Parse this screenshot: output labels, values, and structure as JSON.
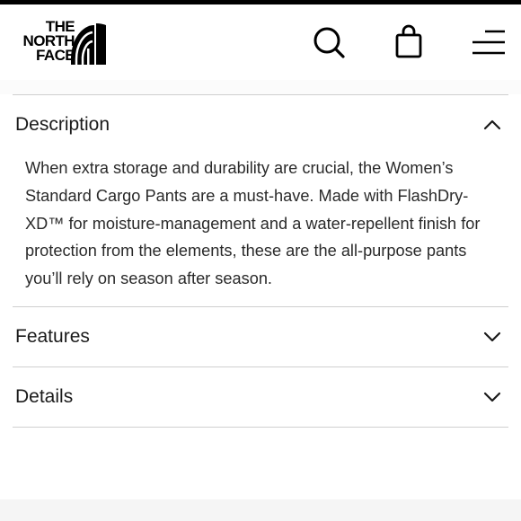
{
  "brand": {
    "logo_lines": [
      "THE",
      "NORTH",
      "FACE"
    ]
  },
  "header": {
    "icons": {
      "search": "search-icon",
      "bag": "shopping-bag-icon",
      "menu": "hamburger-menu-icon"
    }
  },
  "accordion": {
    "description": {
      "title": "Description",
      "expanded": true,
      "text": "When extra storage and durability are crucial, the Women’s Standard Cargo Pants are a must-have. Made with FlashDry-XD™ for moisture-management and a water-repellent finish for protection from the elements, these are the all-purpose pants you’ll rely on season after season."
    },
    "features": {
      "title": "Features",
      "expanded": false
    },
    "details": {
      "title": "Details",
      "expanded": false
    }
  }
}
